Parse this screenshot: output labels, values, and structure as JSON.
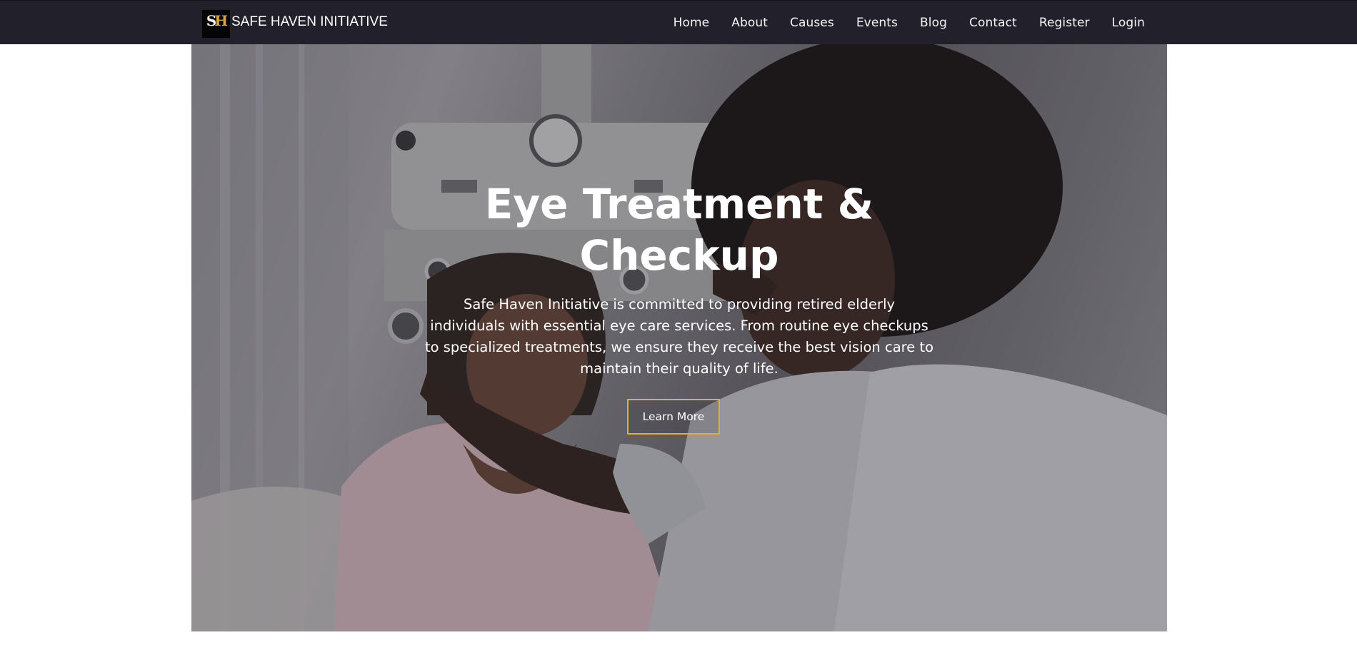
{
  "brand": {
    "logo_text": "SH",
    "name": "SAFE HAVEN INITIATIVE"
  },
  "nav": {
    "items": [
      "Home",
      "About",
      "Causes",
      "Events",
      "Blog",
      "Contact",
      "Register",
      "Login"
    ]
  },
  "hero": {
    "title": "Eye Treatment & Checkup",
    "description": "Safe Haven Initiative is committed to providing retired elderly individuals with essential eye care services. From routine eye checkups to specialized treatments, we ensure they receive the best vision care to maintain their quality of life.",
    "button_label": "Learn More"
  },
  "colors": {
    "navbar": "#22212b",
    "button_border": "#e0b61c",
    "logo_accent": "#d9a441"
  },
  "icons": {
    "logo": "safe-haven-logo"
  }
}
